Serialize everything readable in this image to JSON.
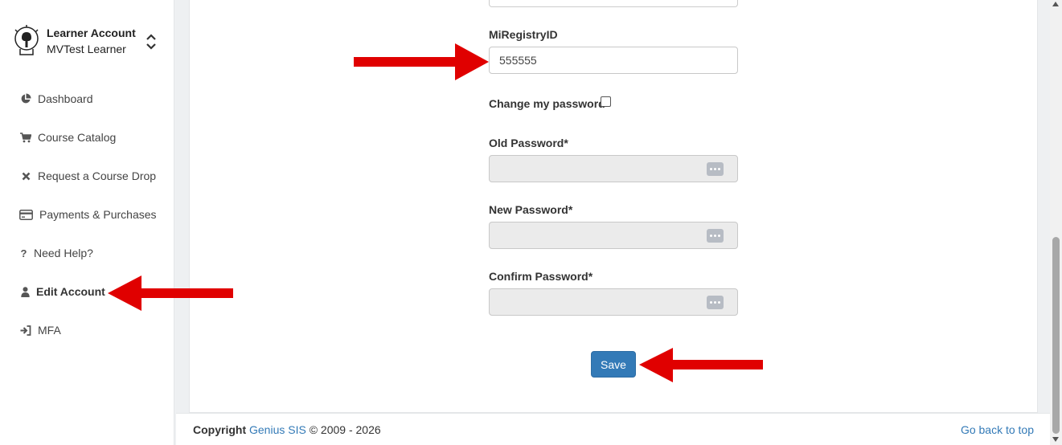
{
  "sidebar": {
    "account_title": "Learner Account",
    "account_user": "MVTest Learner",
    "items": [
      {
        "label": "Dashboard",
        "icon": "pie-chart-icon"
      },
      {
        "label": "Course Catalog",
        "icon": "cart-icon"
      },
      {
        "label": "Request a Course Drop",
        "icon": "x-icon"
      },
      {
        "label": "Payments & Purchases",
        "icon": "credit-card-icon"
      },
      {
        "label": "Need Help?",
        "icon": "question-icon"
      },
      {
        "label": "Edit Account",
        "icon": "user-icon",
        "active": true
      },
      {
        "label": "MFA",
        "icon": "sign-in-icon"
      }
    ]
  },
  "form": {
    "miregistry_label": "MiRegistryID",
    "miregistry_value": "555555",
    "change_password_label": "Change my password",
    "change_password_checked": false,
    "old_password_label": "Old Password*",
    "new_password_label": "New Password*",
    "confirm_password_label": "Confirm Password*",
    "save_label": "Save"
  },
  "footer": {
    "copyright_label": "Copyright",
    "brand": "Genius SIS",
    "years": "© 2009 - 2026",
    "back_to_top": "Go back to top"
  },
  "colors": {
    "accent": "#337ab7",
    "annotation_arrow": "#e00000"
  }
}
